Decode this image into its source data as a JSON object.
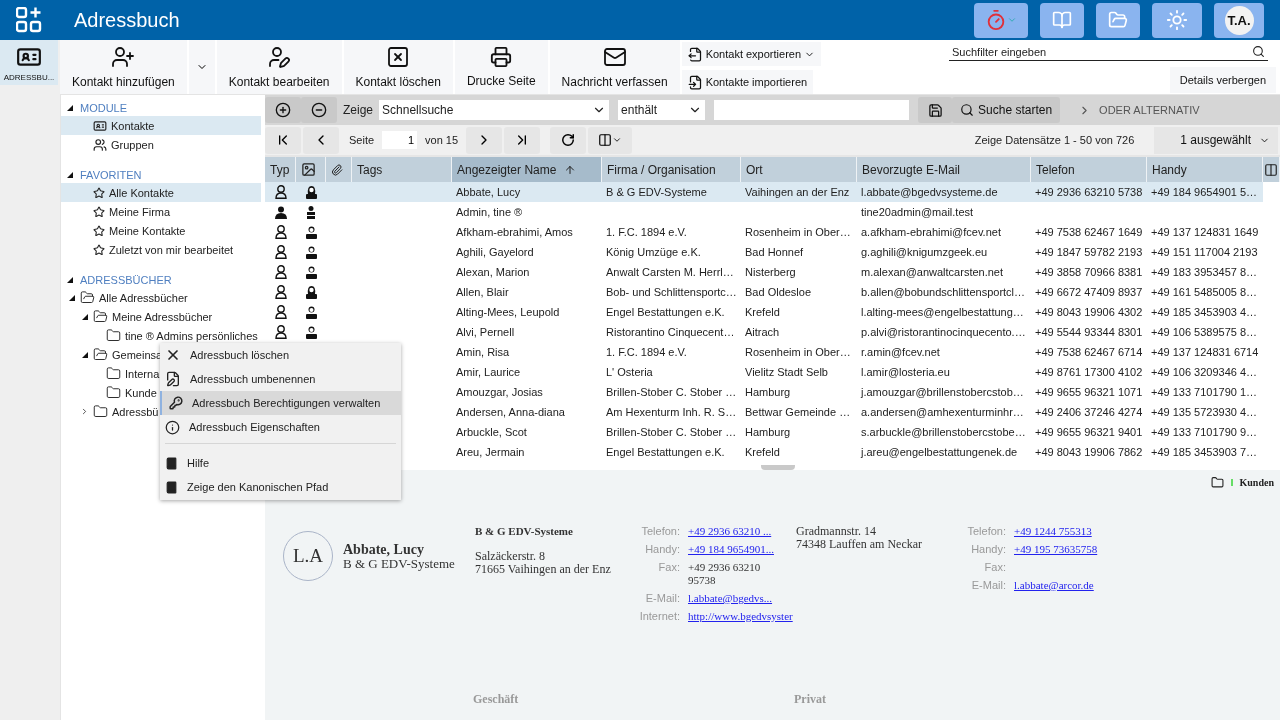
{
  "app_bar": {
    "title": "Adressbuch",
    "user_initials": "T.A."
  },
  "rail": [
    {
      "label": "ADRESSBU...",
      "selected": true
    }
  ],
  "toolbar": {
    "buttons": [
      {
        "kind": "add",
        "label": "Kontakt hinzufügen",
        "menu": true
      },
      {
        "kind": "edit",
        "label": "Kontakt bearbeiten"
      },
      {
        "kind": "delete",
        "label": "Kontakt löschen"
      },
      {
        "kind": "print",
        "label": "Drucke Seite"
      },
      {
        "kind": "mail",
        "label": "Nachricht verfassen"
      }
    ],
    "side_buttons": [
      {
        "kind": "export",
        "label": "Kontakt exportieren",
        "menu": true
      },
      {
        "kind": "import",
        "label": "Kontakte importieren"
      }
    ],
    "search": {
      "placeholder": "Suchfilter eingeben"
    },
    "details_button": "Details verbergen"
  },
  "tree": [
    {
      "title": "MODULE",
      "expanded": true,
      "items": [
        {
          "kind": "contacts",
          "label": "Kontakte",
          "selected": true
        },
        {
          "kind": "groups",
          "label": "Gruppen",
          "selected": false
        }
      ]
    },
    {
      "title": "FAVORITEN",
      "expanded": true,
      "items": [
        {
          "kind": "star",
          "label": "Alle Kontakte",
          "selected": true
        },
        {
          "kind": "star",
          "label": "Meine Firma",
          "selected": false
        },
        {
          "kind": "star",
          "label": "Meine Kontakte",
          "selected": false
        },
        {
          "kind": "star",
          "label": "Zuletzt von mir bearbeitet",
          "selected": false
        }
      ]
    },
    {
      "title": "ADRESSBÜCHER",
      "expanded": true,
      "items": [
        {
          "kind": "folder",
          "label": "Alle Adressbücher",
          "selected": false,
          "expanded": true,
          "children": [
            {
              "kind": "folder",
              "label": "Meine Adressbücher",
              "selected": false,
              "expanded": true,
              "children": [
                {
                  "kind": "folder",
                  "label": "tine ® Admins persönliches",
                  "selected": false
                }
              ]
            },
            {
              "kind": "folder",
              "label": "Gemeinsa",
              "selected": false,
              "expanded": true,
              "children": [
                {
                  "kind": "folder",
                  "label": "Interna",
                  "selected": false
                },
                {
                  "kind": "folder",
                  "label": "Kunde",
                  "selected": false
                }
              ]
            },
            {
              "kind": "folder",
              "label": "Adressbü",
              "selected": false,
              "expanded": false
            }
          ]
        }
      ]
    }
  ],
  "filter": {
    "label": "Zeige",
    "field": "Schnellsuche",
    "operator": "enthält",
    "search_button": "Suche starten",
    "alternative": "ODER ALTERNATIV"
  },
  "paging": {
    "page_label": "Seite",
    "page": "1",
    "page_count": "von 15",
    "summary": "Zeige Datensätze 1 - 50 von 726",
    "selection": "1 ausgewählt"
  },
  "table": {
    "columns": [
      {
        "kind": "text",
        "label": "Typ",
        "sorted": false
      },
      {
        "kind": "photo",
        "sorted": false
      },
      {
        "kind": "attachment",
        "sorted": false
      },
      {
        "kind": "text",
        "label": "Tags",
        "sorted": false
      },
      {
        "kind": "text",
        "label": "Angezeigter Name",
        "sorted": true
      },
      {
        "kind": "text",
        "label": "Firma / Organisation",
        "sorted": false
      },
      {
        "kind": "text",
        "label": "Ort",
        "sorted": false
      },
      {
        "kind": "text",
        "label": "Bevorzugte E-Mail",
        "sorted": false
      },
      {
        "kind": "text",
        "label": "Telefon",
        "sorted": false
      },
      {
        "kind": "text",
        "label": "Handy",
        "sorted": false
      }
    ],
    "rows": [
      {
        "selected": true,
        "kind": "woman",
        "name": "Abbate, Lucy",
        "company": "B & G EDV-Systeme",
        "city": "Vaihingen an der Enz",
        "email": "l.abbate@bgedvsysteme.de",
        "phone": "+49 2936 63210 5738",
        "mobile": "+49 184 9654901 5…"
      },
      {
        "selected": false,
        "kind": "user",
        "name": "Admin, tine ®",
        "email": "tine20admin@mail.test"
      },
      {
        "selected": false,
        "kind": "man",
        "name": "Afkham-ebrahimi, Amos",
        "company": "1. F.C. 1894 e.V.",
        "city": "Rosenheim in Ober…",
        "email": "a.afkham-ebrahimi@fcev.net",
        "phone": "+49 7538 62467 1649",
        "mobile": "+49 137 124831 1649"
      },
      {
        "selected": false,
        "kind": "man",
        "name": "Aghili, Gayelord",
        "company": "König Umzüge e.K.",
        "city": "Bad Honnef",
        "email": "g.aghili@knigumzgeek.eu",
        "phone": "+49 1847 59782 2193",
        "mobile": "+49 151 117004 2193"
      },
      {
        "selected": false,
        "kind": "man",
        "name": "Alexan, Marion",
        "company": "Anwalt Carsten M. Herrl…",
        "city": "Nisterberg",
        "email": "m.alexan@anwaltcarsten.net",
        "phone": "+49 3858 70966 8381",
        "mobile": "+49 183 3953457 8…"
      },
      {
        "selected": false,
        "kind": "woman",
        "name": "Allen, Blair",
        "company": "Bob- und Schlittensportc…",
        "city": "Bad Oldesloe",
        "email": "b.allen@bobundschlittensportcl…",
        "phone": "+49 6672 47409 8937",
        "mobile": "+49 161 5485005 8…"
      },
      {
        "selected": false,
        "kind": "man",
        "name": "Alting-Mees, Leupold",
        "company": "Engel Bestattungen e.K.",
        "city": "Krefeld",
        "email": "l.alting-mees@engelbestattung…",
        "phone": "+49 8043 19906 4302",
        "mobile": "+49 185 3453903 4…"
      },
      {
        "selected": false,
        "kind": "man",
        "name": "Alvi, Pernell",
        "company": "Ristorantino Cinquecent…",
        "city": "Aitrach",
        "email": "p.alvi@ristorantinocinquecento.…",
        "phone": "+49 5544 93344 8301",
        "mobile": "+49 106 5389575 8…"
      },
      {
        "selected": false,
        "name": "Amin, Risa",
        "company": "1. F.C. 1894 e.V.",
        "city": "Rosenheim in Ober…",
        "email": "r.amin@fcev.net",
        "phone": "+49 7538 62467 6714",
        "mobile": "+49 137 124831 6714"
      },
      {
        "selected": false,
        "name": "Amir, Laurice",
        "company": "L' Osteria",
        "city": "Vielitz Stadt Selb",
        "email": "l.amir@losteria.eu",
        "phone": "+49 8761 17300 4102",
        "mobile": "+49 106 3209346 4…"
      },
      {
        "selected": false,
        "name": "Amouzgar, Josias",
        "company": "Brillen-Stober C. Stober …",
        "city": "Hamburg",
        "email": "j.amouzgar@brillenstobercstob…",
        "phone": "+49 9655 96321 1071",
        "mobile": "+49 133 7101790 1…"
      },
      {
        "selected": false,
        "name": "Andersen, Anna-diana",
        "company": "Am Hexenturm Inh. R. S…",
        "city": "Bettwar Gemeinde …",
        "email": "a.andersen@amhexenturminhr…",
        "phone": "+49 2406 37246 4274",
        "mobile": "+49 135 5723930 4…"
      },
      {
        "selected": false,
        "name": "Arbuckle, Scot",
        "company": "Brillen-Stober C. Stober …",
        "city": "Hamburg",
        "email": "s.arbuckle@brillenstobercstobe…",
        "phone": "+49 9655 96321 9401",
        "mobile": "+49 133 7101790 9…"
      },
      {
        "selected": false,
        "name": "Areu, Jermain",
        "company": "Engel Bestattungen e.K.",
        "city": "Krefeld",
        "email": "j.areu@engelbestattungenek.de",
        "phone": "+49 8043 19906 7862",
        "mobile": "+49 185 3453903 7…"
      }
    ]
  },
  "context_menu": [
    {
      "items": [
        {
          "kind": "delete",
          "label": "Adressbuch löschen",
          "selected": false
        },
        {
          "kind": "rename",
          "label": "Adressbuch umbenennen",
          "selected": false
        },
        {
          "kind": "permissions",
          "label": "Adressbuch Berechtigungen verwalten",
          "selected": true
        },
        {
          "kind": "info",
          "label": "Adressbuch Eigenschaften",
          "selected": false
        }
      ]
    },
    {
      "items": [
        {
          "kind": "help",
          "label": "Hilfe",
          "selected": false
        },
        {
          "kind": "help",
          "label": "Zeige den Kanonischen Pfad",
          "selected": false
        }
      ]
    }
  ],
  "details": {
    "folder": "Kunden",
    "initials": "L.A",
    "name": "Abbate, Lucy",
    "company": "B & G EDV-Systeme",
    "business": {
      "title": "B & G EDV-Systeme",
      "street": "Salzäckerstr. 8",
      "city": "71665 Vaihingen an der Enz",
      "caption": "Geschäft",
      "contacts": [
        {
          "label": "Telefon:",
          "value": "+49 2936 63210 ...",
          "link": true
        },
        {
          "label": "Handy:",
          "value": "+49 184 9654901...",
          "link": true
        },
        {
          "label": "Fax:",
          "value": "+49 2936 63210 95738",
          "link": false
        },
        {
          "label": "E-Mail:",
          "value": "l.abbate@bgedvs...",
          "link": true
        },
        {
          "label": "Internet:",
          "value": "http://www.bgedvsyster",
          "link": true
        }
      ]
    },
    "private": {
      "street": "Gradmannstr. 14",
      "city": "74348 Lauffen am Neckar",
      "caption": "Privat",
      "contacts": [
        {
          "label": "Telefon:",
          "value": "+49 1244 755313",
          "link": true
        },
        {
          "label": "Handy:",
          "value": "+49 195 73635758",
          "link": true
        },
        {
          "label": "Fax:"
        },
        {
          "label": "E-Mail:",
          "value": "l.abbate@arcor.de",
          "link": true
        }
      ]
    }
  }
}
